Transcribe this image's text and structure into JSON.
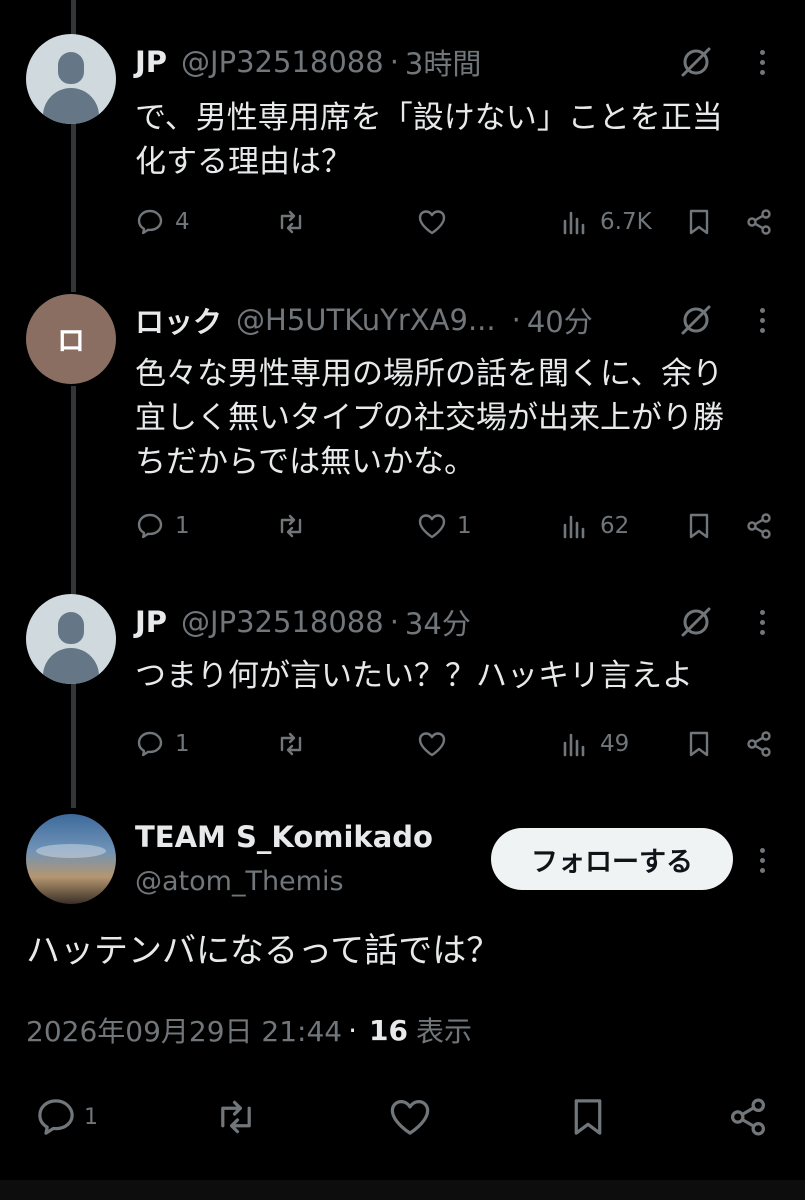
{
  "replies": [
    {
      "name": "JP",
      "handle": "@JP32518088",
      "dot": "·",
      "time": "3時間",
      "text": "で、男性専用席を「設けない」ことを正当\n化する理由は？",
      "avatar": "default-avatar",
      "counts": {
        "reply": "4",
        "retweet": "",
        "like": "",
        "views": "6.7K"
      }
    },
    {
      "name": "ロック",
      "handle": "@H5UTKuYrXA9...",
      "dot": "·",
      "time": "40分",
      "text": "色々な男性専用の場所の話を聞くに、余り\n宜しく無いタイプの社交場が出来上がり勝\nちだからでは無いかな。",
      "avatar_letter": "ロ",
      "counts": {
        "reply": "1",
        "retweet": "",
        "like": "1",
        "views": "62"
      }
    },
    {
      "name": "JP",
      "handle": "@JP32518088",
      "dot": "·",
      "time": "34分",
      "text": "つまり何が言いたい？？ハッキリ言えよ",
      "avatar": "default-avatar",
      "counts": {
        "reply": "1",
        "retweet": "",
        "like": "",
        "views": "49"
      }
    }
  ],
  "main_tweet": {
    "name": "TEAM S_Komikado",
    "handle": "@atom_Themis",
    "follow_label": "フォローする",
    "text": "ハッテンバになるって話では？",
    "timestamp": "2026年09月29日 21:44",
    "dot": "·",
    "views_count": "16",
    "views_label": "表示",
    "reply_count": "1"
  },
  "colors": {
    "background": "#000000",
    "text": "#e7e9ea",
    "secondary": "#71767b",
    "thread_line": "#333639",
    "follow_bg": "#eff3f4"
  },
  "icons": [
    "grok-icon",
    "more-icon",
    "reply-icon",
    "retweet-icon",
    "like-icon",
    "views-icon",
    "bookmark-icon",
    "share-icon"
  ]
}
